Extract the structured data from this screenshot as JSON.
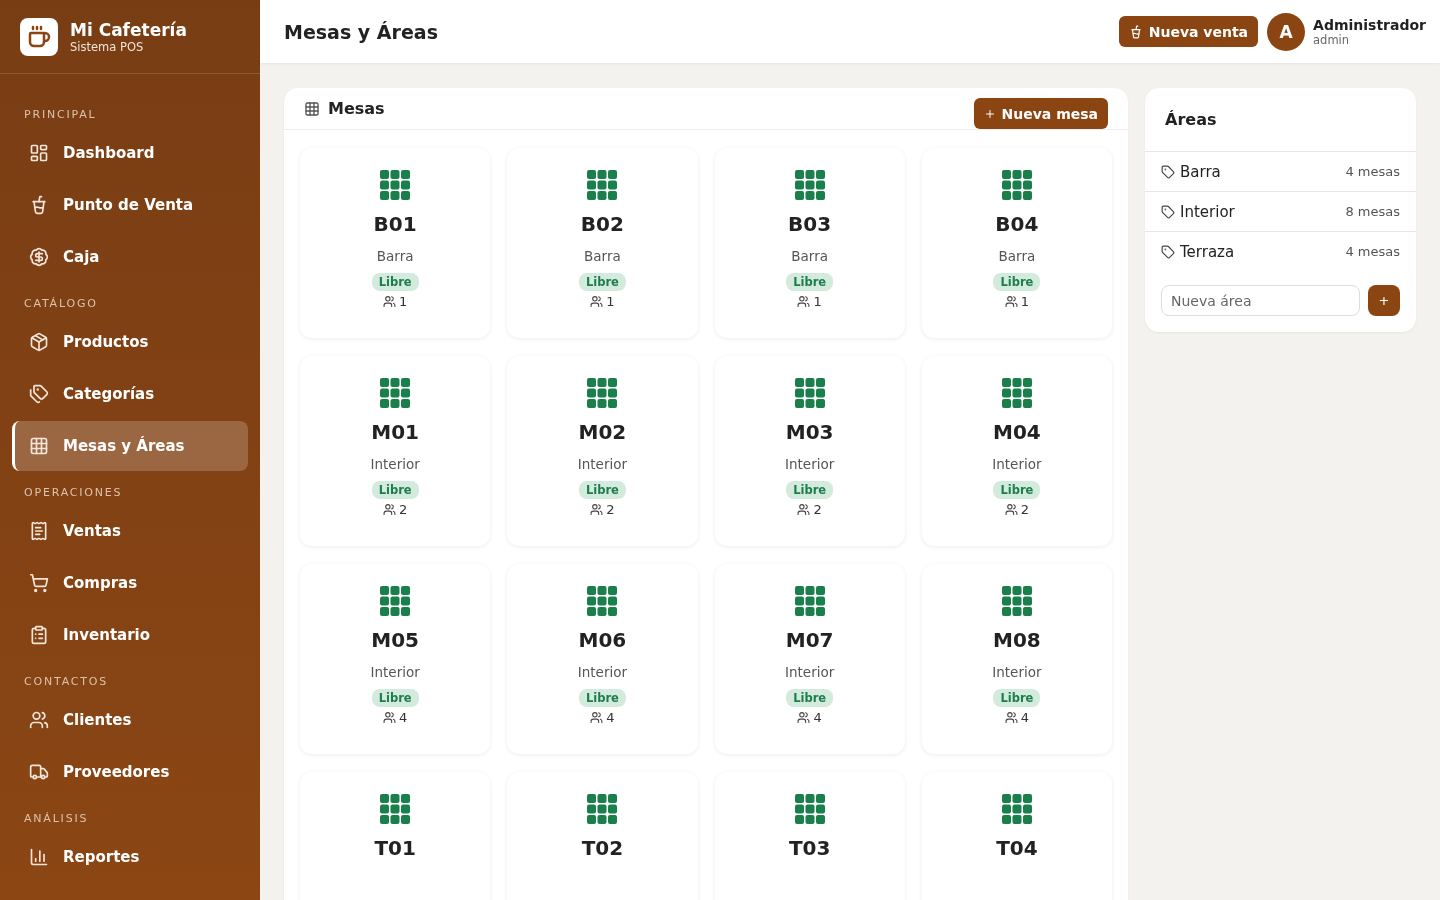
{
  "brand": {
    "name": "Mi Cafetería",
    "subtitle": "Sistema POS"
  },
  "sidebar": {
    "sections": [
      {
        "title": "PRINCIPAL",
        "items": [
          {
            "label": "Dashboard",
            "selected": false
          },
          {
            "label": "Punto de Venta",
            "selected": false
          },
          {
            "label": "Caja",
            "selected": false
          }
        ]
      },
      {
        "title": "CATÁLOGO",
        "items": [
          {
            "label": "Productos",
            "selected": false
          },
          {
            "label": "Categorías",
            "selected": false
          },
          {
            "label": "Mesas y Áreas",
            "selected": true
          }
        ]
      },
      {
        "title": "OPERACIONES",
        "items": [
          {
            "label": "Ventas",
            "selected": false
          },
          {
            "label": "Compras",
            "selected": false
          },
          {
            "label": "Inventario",
            "selected": false
          }
        ]
      },
      {
        "title": "CONTACTOS",
        "items": [
          {
            "label": "Clientes",
            "selected": false
          },
          {
            "label": "Proveedores",
            "selected": false
          }
        ]
      },
      {
        "title": "ANÁLISIS",
        "items": [
          {
            "label": "Reportes",
            "selected": false
          }
        ]
      }
    ]
  },
  "header": {
    "title": "Mesas y Áreas",
    "new_sale_button": "Nueva venta",
    "user": {
      "initial": "A",
      "name": "Administrador",
      "role": "admin"
    }
  },
  "tables_panel": {
    "title": "Mesas",
    "new_button": "Nueva mesa",
    "tables": [
      {
        "name": "B01",
        "area": "Barra",
        "status": "Libre",
        "seats": "1"
      },
      {
        "name": "B02",
        "area": "Barra",
        "status": "Libre",
        "seats": "1"
      },
      {
        "name": "B03",
        "area": "Barra",
        "status": "Libre",
        "seats": "1"
      },
      {
        "name": "B04",
        "area": "Barra",
        "status": "Libre",
        "seats": "1"
      },
      {
        "name": "M01",
        "area": "Interior",
        "status": "Libre",
        "seats": "2"
      },
      {
        "name": "M02",
        "area": "Interior",
        "status": "Libre",
        "seats": "2"
      },
      {
        "name": "M03",
        "area": "Interior",
        "status": "Libre",
        "seats": "2"
      },
      {
        "name": "M04",
        "area": "Interior",
        "status": "Libre",
        "seats": "2"
      },
      {
        "name": "M05",
        "area": "Interior",
        "status": "Libre",
        "seats": "4"
      },
      {
        "name": "M06",
        "area": "Interior",
        "status": "Libre",
        "seats": "4"
      },
      {
        "name": "M07",
        "area": "Interior",
        "status": "Libre",
        "seats": "4"
      },
      {
        "name": "M08",
        "area": "Interior",
        "status": "Libre",
        "seats": "4"
      },
      {
        "name": "T01"
      },
      {
        "name": "T02"
      },
      {
        "name": "T03"
      },
      {
        "name": "T04"
      }
    ]
  },
  "areas_panel": {
    "title": "Áreas",
    "areas": [
      {
        "name": "Barra",
        "count": "4 mesas"
      },
      {
        "name": "Interior",
        "count": "8 mesas"
      },
      {
        "name": "Terraza",
        "count": "4 mesas"
      }
    ],
    "new_area": {
      "placeholder": "Nueva área",
      "button": "+"
    }
  }
}
